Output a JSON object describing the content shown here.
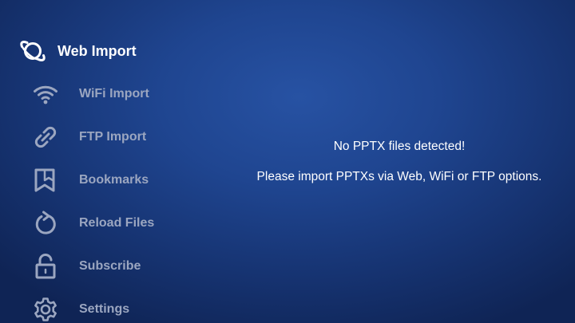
{
  "sidebar": {
    "items": [
      {
        "label": "Web Import",
        "icon": "planet-icon",
        "active": true
      },
      {
        "label": "WiFi Import",
        "icon": "wifi-icon",
        "active": false
      },
      {
        "label": "FTP Import",
        "icon": "link-icon",
        "active": false
      },
      {
        "label": "Bookmarks",
        "icon": "bookmark-icon",
        "active": false
      },
      {
        "label": "Reload Files",
        "icon": "reload-icon",
        "active": false
      },
      {
        "label": "Subscribe",
        "icon": "unlock-icon",
        "active": false
      },
      {
        "label": "Settings",
        "icon": "gear-icon",
        "active": false
      }
    ]
  },
  "main": {
    "empty_title": "No PPTX files detected!",
    "empty_hint": "Please import PPTXs via Web, WiFi or FTP options."
  },
  "colors": {
    "background": "#1f4590",
    "active_text": "#ffffff",
    "inactive_text": "#9ba6c0"
  }
}
